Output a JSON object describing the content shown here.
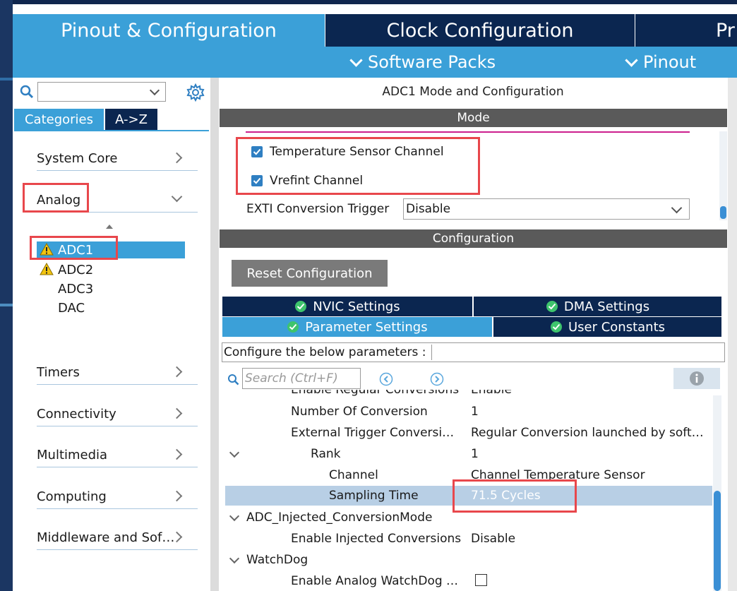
{
  "main_tabs": [
    "Pinout & Configuration",
    "Clock Configuration",
    "Pr"
  ],
  "subnav": [
    "Software Packs",
    "Pinout"
  ],
  "left": {
    "search_value": "",
    "view_tabs": [
      "Categories",
      "A->Z"
    ],
    "categories": [
      "System Core",
      "Analog",
      "Timers",
      "Connectivity",
      "Multimedia",
      "Computing",
      "Middleware and Sof…"
    ],
    "analog_items": [
      "ADC1",
      "ADC2",
      "ADC3",
      "DAC"
    ]
  },
  "mode": {
    "title": "ADC1 Mode and Configuration",
    "section": "Mode",
    "checks": [
      {
        "label": "Temperature Sensor Channel",
        "checked": true
      },
      {
        "label": "Vrefint Channel",
        "checked": true
      }
    ],
    "exti_label": "EXTI Conversion Trigger",
    "exti_value": "Disable"
  },
  "config": {
    "section": "Configuration",
    "reset_label": "Reset Configuration",
    "tabs": [
      "NVIC Settings",
      "DMA Settings",
      "Parameter Settings",
      "User Constants"
    ],
    "configure_label": "Configure the below parameters :",
    "search_placeholder": "Search (Ctrl+F)"
  },
  "params": [
    {
      "key": "Enable Regular Conversions",
      "value": "Enable"
    },
    {
      "key": "Number Of Conversion",
      "value": "1"
    },
    {
      "key": "External Trigger Conversi…",
      "value": "Regular Conversion launched by soft…"
    },
    {
      "key": "Rank",
      "value": "1"
    },
    {
      "key": "Channel",
      "value": "Channel Temperature Sensor"
    },
    {
      "key": "Sampling Time",
      "value": "71.5 Cycles"
    },
    {
      "key": "ADC_Injected_ConversionMode",
      "value": ""
    },
    {
      "key": "Enable Injected Conversions",
      "value": "Disable"
    },
    {
      "key": "WatchDog",
      "value": ""
    },
    {
      "key": "Enable Analog WatchDog …",
      "value": ""
    }
  ],
  "colors": {
    "accent": "#3ba0d8",
    "navy": "#0b2650",
    "highlight": "#e8474c",
    "section_bar": "#5a5a5a"
  }
}
